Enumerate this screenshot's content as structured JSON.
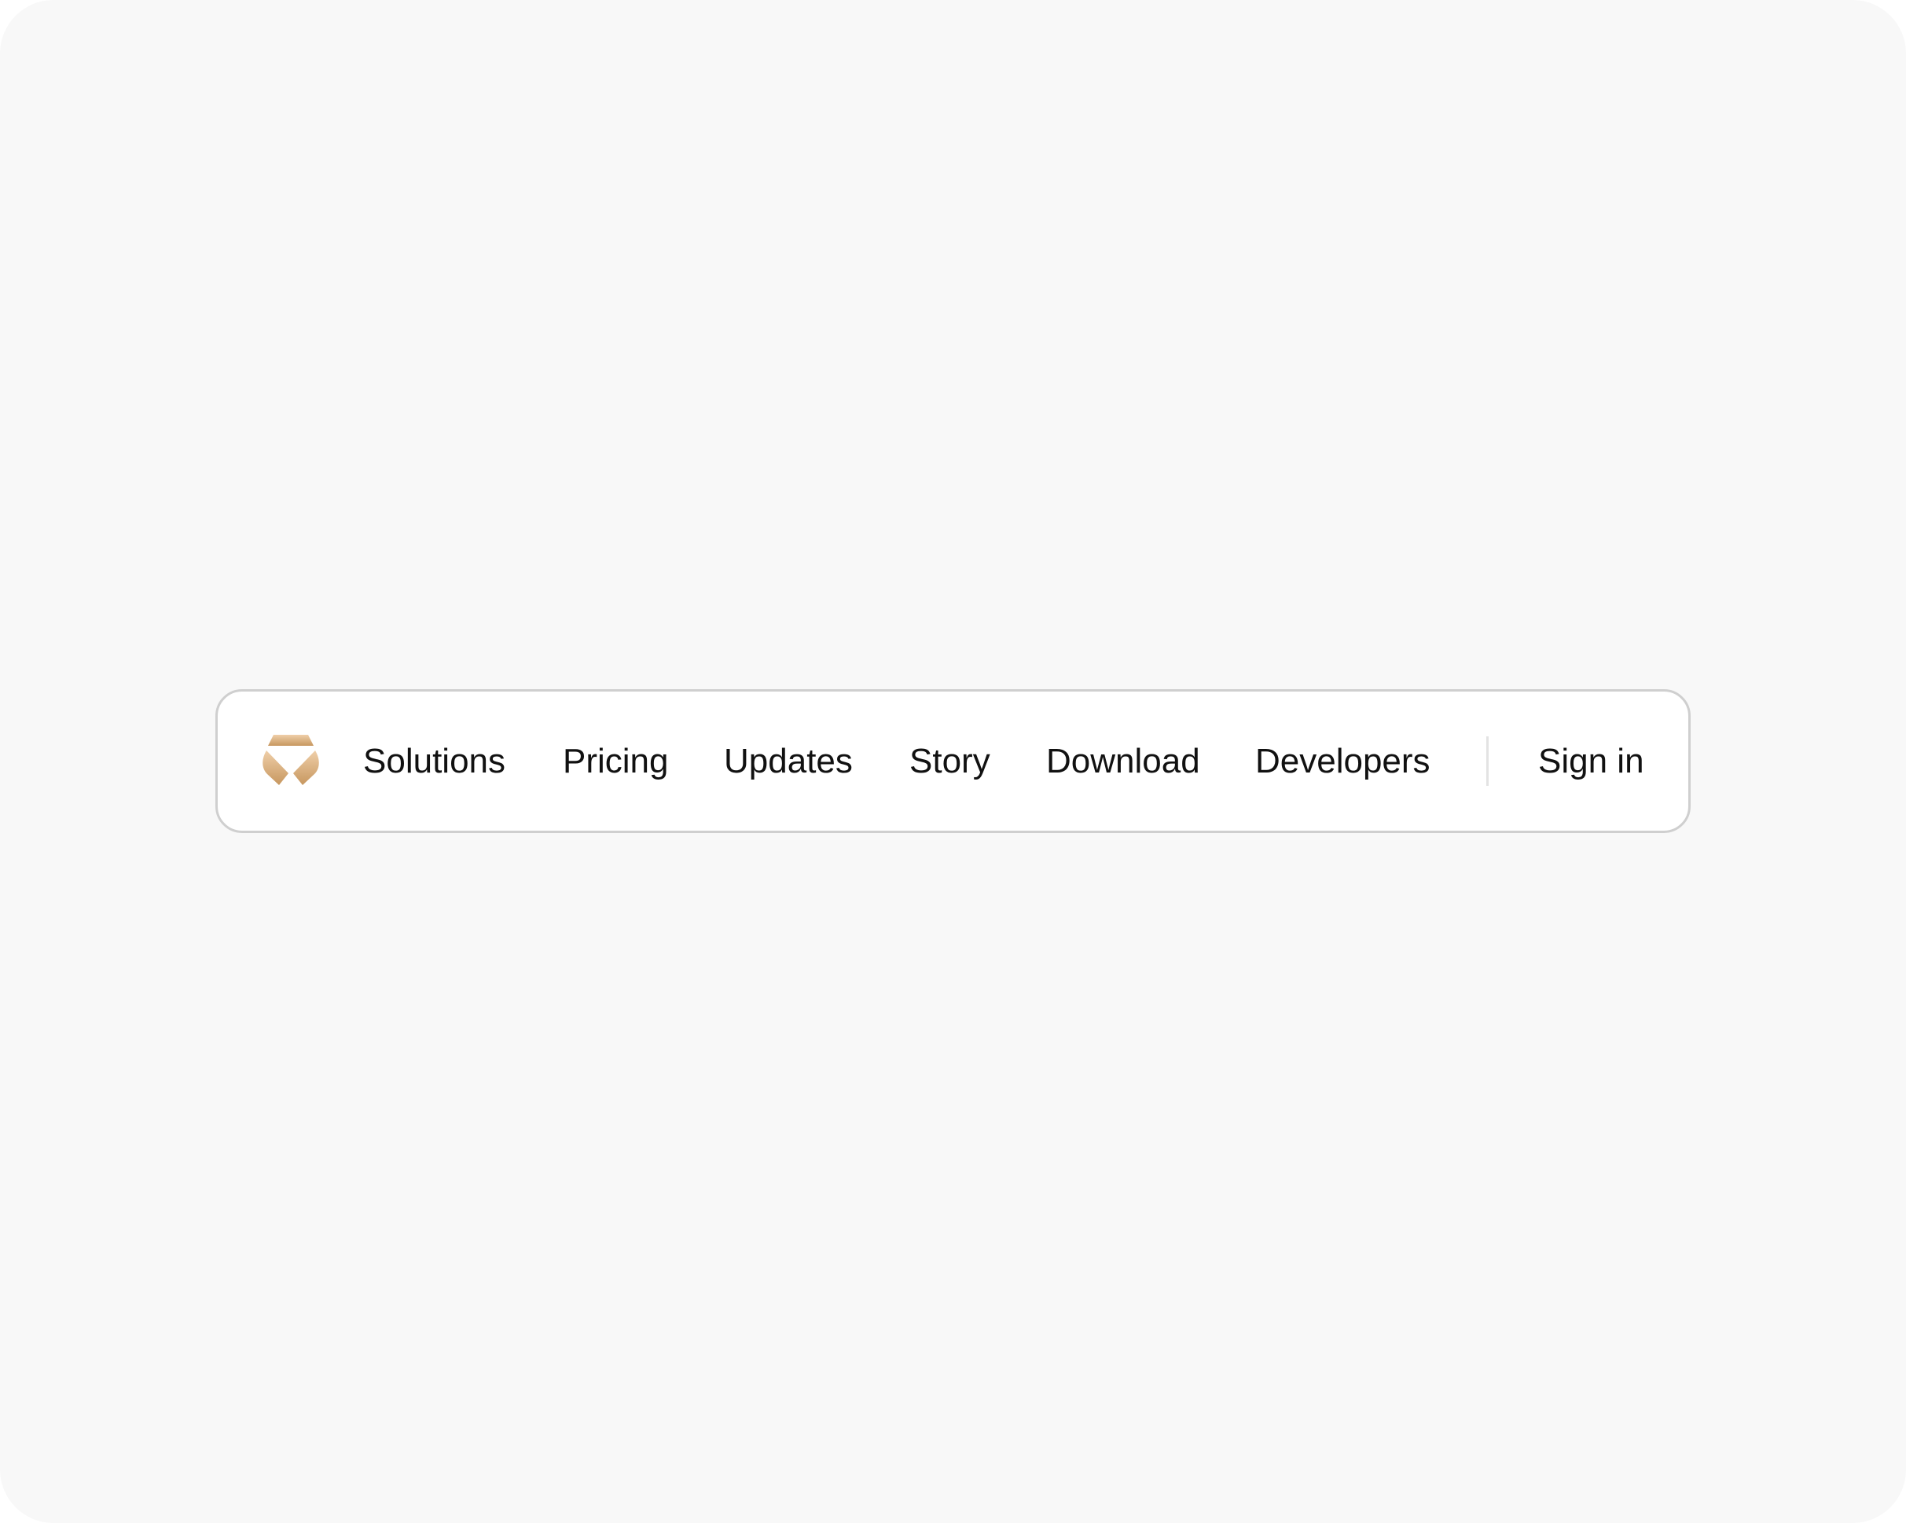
{
  "colors": {
    "page_background": "#f8f8f8",
    "navbar_background": "#ffffff",
    "navbar_border": "#cfcfcf",
    "text": "#111111",
    "logo_gradient_light": "#edc9a0",
    "logo_gradient_dark": "#c89a66"
  },
  "navbar": {
    "logo": {
      "icon": "brand-logo-icon"
    },
    "links": [
      {
        "label": "Solutions"
      },
      {
        "label": "Pricing"
      },
      {
        "label": "Updates"
      },
      {
        "label": "Story"
      },
      {
        "label": "Download"
      },
      {
        "label": "Developers"
      }
    ],
    "sign_in_label": "Sign in"
  }
}
